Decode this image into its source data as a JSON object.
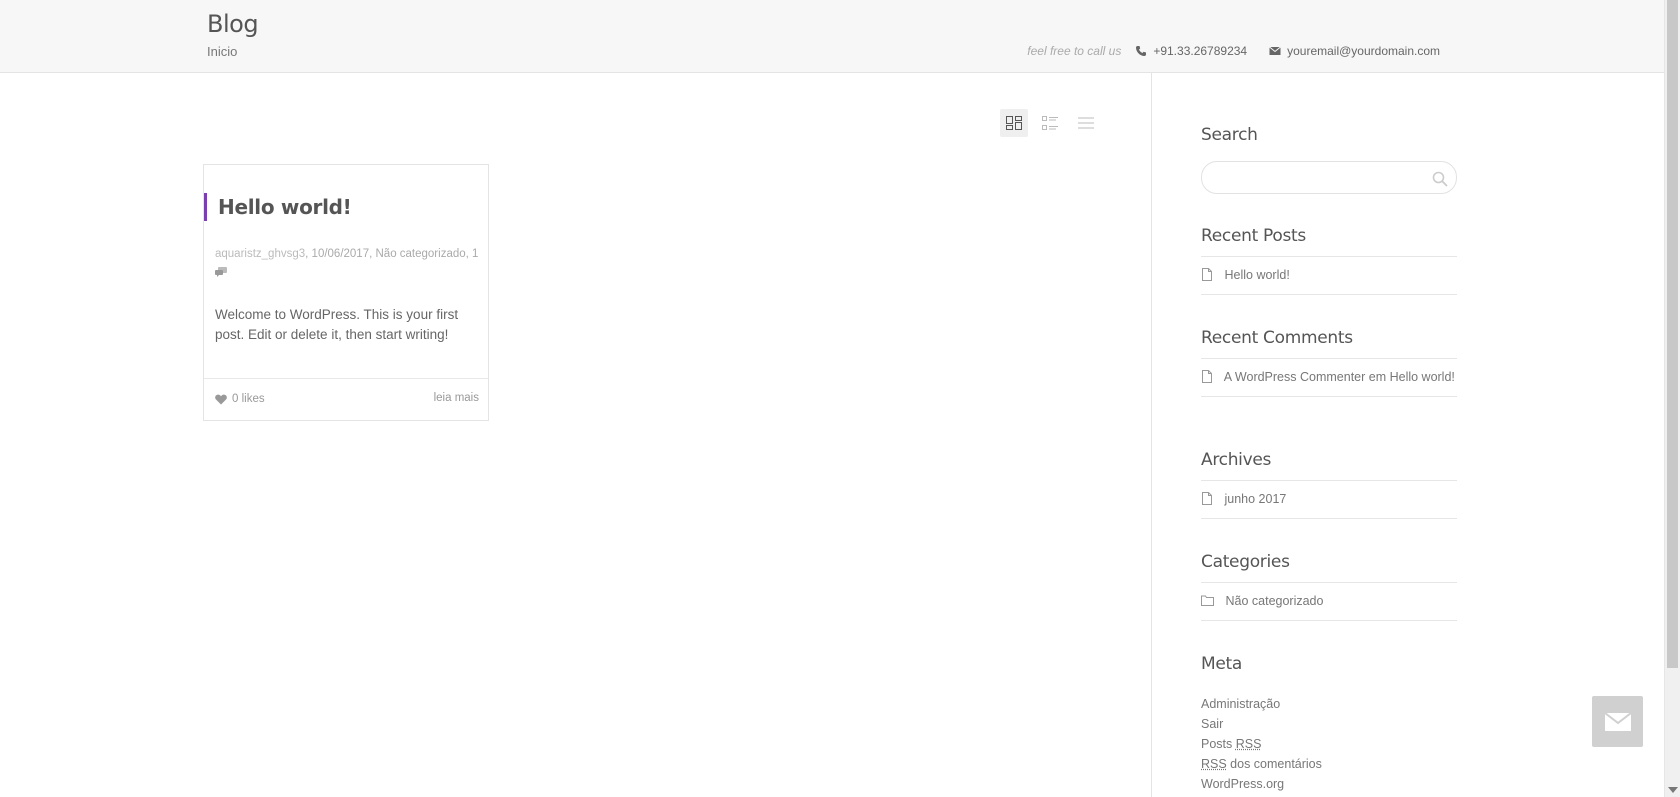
{
  "header": {
    "title": "Blog",
    "breadcrumb": "Inicio",
    "tagline": "feel free to call us",
    "phone": "+91.33.26789234",
    "email": "youremail@yourdomain.com"
  },
  "layout_options": [
    "grid",
    "list-thumbnails",
    "list"
  ],
  "post": {
    "title": "Hello world!",
    "author": "aquaristz_ghvsg3",
    "meta_rest": ", 10/06/2017, Não categorizado, 1",
    "excerpt": "Welcome to WordPress. This is your first post. Edit or delete it, then start writing!",
    "likes": "0 likes",
    "read_more": "leia mais",
    "accent_color": "#7b3fb0"
  },
  "sidebar": {
    "search_title": "Search",
    "search_placeholder": "",
    "recent_posts_title": "Recent Posts",
    "recent_posts": [
      "Hello world!"
    ],
    "recent_comments_title": "Recent Comments",
    "recent_comment": "A WordPress Commenter em Hello world!",
    "archives_title": "Archives",
    "archives": [
      "junho 2017"
    ],
    "categories_title": "Categories",
    "categories": [
      "Não categorizado"
    ],
    "meta_title": "Meta",
    "meta": {
      "admin": "Administração",
      "logout": "Sair",
      "posts_prefix": "Posts ",
      "rss": "RSS",
      "comments_suffix": " dos comentários",
      "wordpress_org": "WordPress.org"
    }
  }
}
